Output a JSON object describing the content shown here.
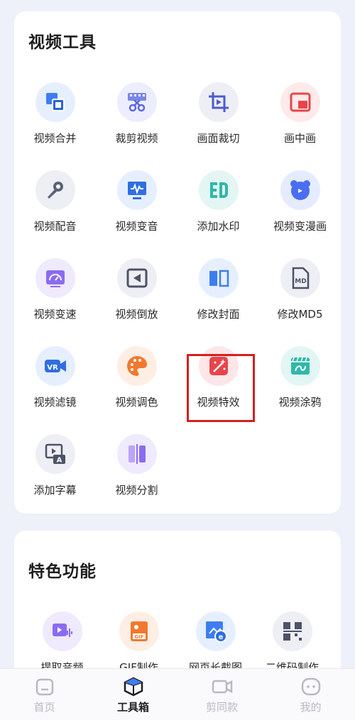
{
  "video_tools": {
    "title": "视频工具",
    "items": [
      {
        "label": "视频合并",
        "icon": "merge-icon"
      },
      {
        "label": "裁剪视频",
        "icon": "cut-video-icon"
      },
      {
        "label": "画面裁切",
        "icon": "crop-icon"
      },
      {
        "label": "画中画",
        "icon": "picture-in-picture-icon"
      },
      {
        "label": "视频配音",
        "icon": "microphone-icon"
      },
      {
        "label": "视频变音",
        "icon": "voice-change-icon"
      },
      {
        "label": "添加水印",
        "icon": "watermark-icon"
      },
      {
        "label": "视频变漫画",
        "icon": "cartoon-bear-icon"
      },
      {
        "label": "视频变速",
        "icon": "speedometer-icon"
      },
      {
        "label": "视频倒放",
        "icon": "rewind-icon"
      },
      {
        "label": "修改封面",
        "icon": "book-cover-icon"
      },
      {
        "label": "修改MD5",
        "icon": "md5-file-icon"
      },
      {
        "label": "视频滤镜",
        "icon": "vr-camera-icon"
      },
      {
        "label": "视频调色",
        "icon": "palette-icon"
      },
      {
        "label": "视频特效",
        "icon": "magic-wand-icon"
      },
      {
        "label": "视频涂鸦",
        "icon": "doodle-icon"
      },
      {
        "label": "添加字幕",
        "icon": "subtitle-icon"
      },
      {
        "label": "视频分割",
        "icon": "split-icon"
      }
    ]
  },
  "featured": {
    "title": "特色功能",
    "items": [
      {
        "label": "提取音频",
        "icon": "extract-audio-icon"
      },
      {
        "label": "GIF制作",
        "icon": "gif-icon"
      },
      {
        "label": "网页长截图",
        "icon": "web-screenshot-icon"
      },
      {
        "label": "二维码制作",
        "icon": "qrcode-icon"
      }
    ]
  },
  "tabbar": {
    "tabs": [
      {
        "label": "首页",
        "icon": "home-icon"
      },
      {
        "label": "工具箱",
        "icon": "toolbox-icon",
        "active": true
      },
      {
        "label": "剪同款",
        "icon": "video-camera-icon"
      },
      {
        "label": "我的",
        "icon": "profile-icon"
      }
    ]
  },
  "colors": {
    "background": "#eef0fa",
    "highlight": "#d42020",
    "accent_blue": "#3d7df0",
    "accent_red": "#e8454a",
    "accent_purple": "#8a6cf0"
  }
}
